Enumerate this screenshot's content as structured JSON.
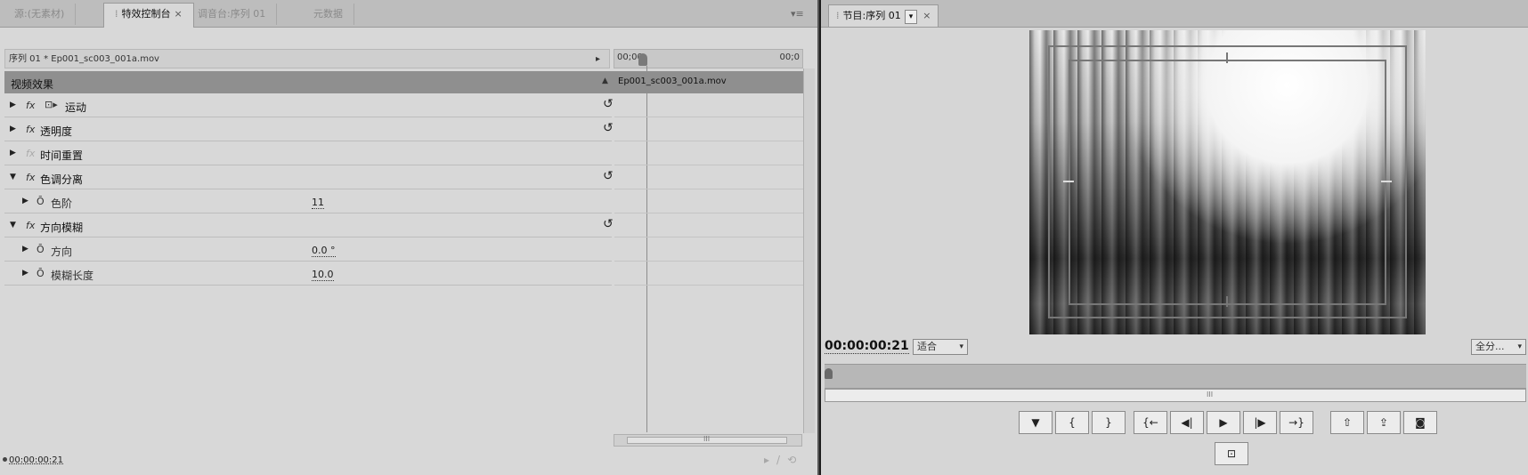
{
  "left_panel": {
    "tabs": [
      {
        "label": "源:(无素材)"
      },
      {
        "label": "特效控制台"
      },
      {
        "label": "调音台:序列 01"
      },
      {
        "label": "元数据"
      }
    ],
    "active_tab_close": "×",
    "panel_menu": "▾≡",
    "header": {
      "clip_path": "序列 01 * Ep001_sc003_001a.mov",
      "arrow": "▸"
    },
    "timeline": {
      "start_tc": "00;00",
      "end_tc": "00;0",
      "clip_name": "Ep001_sc003_001a.mov"
    },
    "section": {
      "label": "视频效果",
      "collapse": "▲"
    },
    "effects": [
      {
        "name": "运动",
        "fx": "fx",
        "expanded": false,
        "reset": "↺"
      },
      {
        "name": "透明度",
        "fx": "fx",
        "expanded": false,
        "reset": "↺"
      },
      {
        "name": "时间重置",
        "fx": "fx",
        "expanded": false,
        "reset": ""
      },
      {
        "name": "色调分离",
        "fx": "fx",
        "expanded": true,
        "reset": "↺"
      },
      {
        "name": "方向模糊",
        "fx": "fx",
        "expanded": true,
        "reset": "↺"
      }
    ],
    "params": {
      "posterize_level": {
        "label": "色阶",
        "value": "11"
      },
      "direction": {
        "label": "方向",
        "value": "0.0 °"
      },
      "blur_length": {
        "label": "模糊长度",
        "value": "10.0"
      }
    },
    "timecode": "00:00:00:21",
    "scroll_grip": "III"
  },
  "program_monitor": {
    "tab_label": "节目:序列 01",
    "tab_dropdown": "▾",
    "tab_close": "×",
    "timecode": "00:00:00:21",
    "fit_label": "适合",
    "full_label": "全分...",
    "caret": "▾",
    "scroll_grip": "III",
    "transport": [
      {
        "name": "add-marker",
        "glyph": "▼"
      },
      {
        "name": "mark-in",
        "glyph": "{"
      },
      {
        "name": "mark-out",
        "glyph": "}"
      },
      {
        "name": "go-to-in",
        "glyph": "{←"
      },
      {
        "name": "step-back",
        "glyph": "◀|"
      },
      {
        "name": "play",
        "glyph": "▶"
      },
      {
        "name": "step-forward",
        "glyph": "|▶"
      },
      {
        "name": "go-to-out",
        "glyph": "→}"
      },
      {
        "name": "lift",
        "glyph": "⇧"
      },
      {
        "name": "extract",
        "glyph": "⇪"
      },
      {
        "name": "export-frame",
        "glyph": "◙"
      }
    ],
    "safe_margins_glyph": "⊡"
  }
}
